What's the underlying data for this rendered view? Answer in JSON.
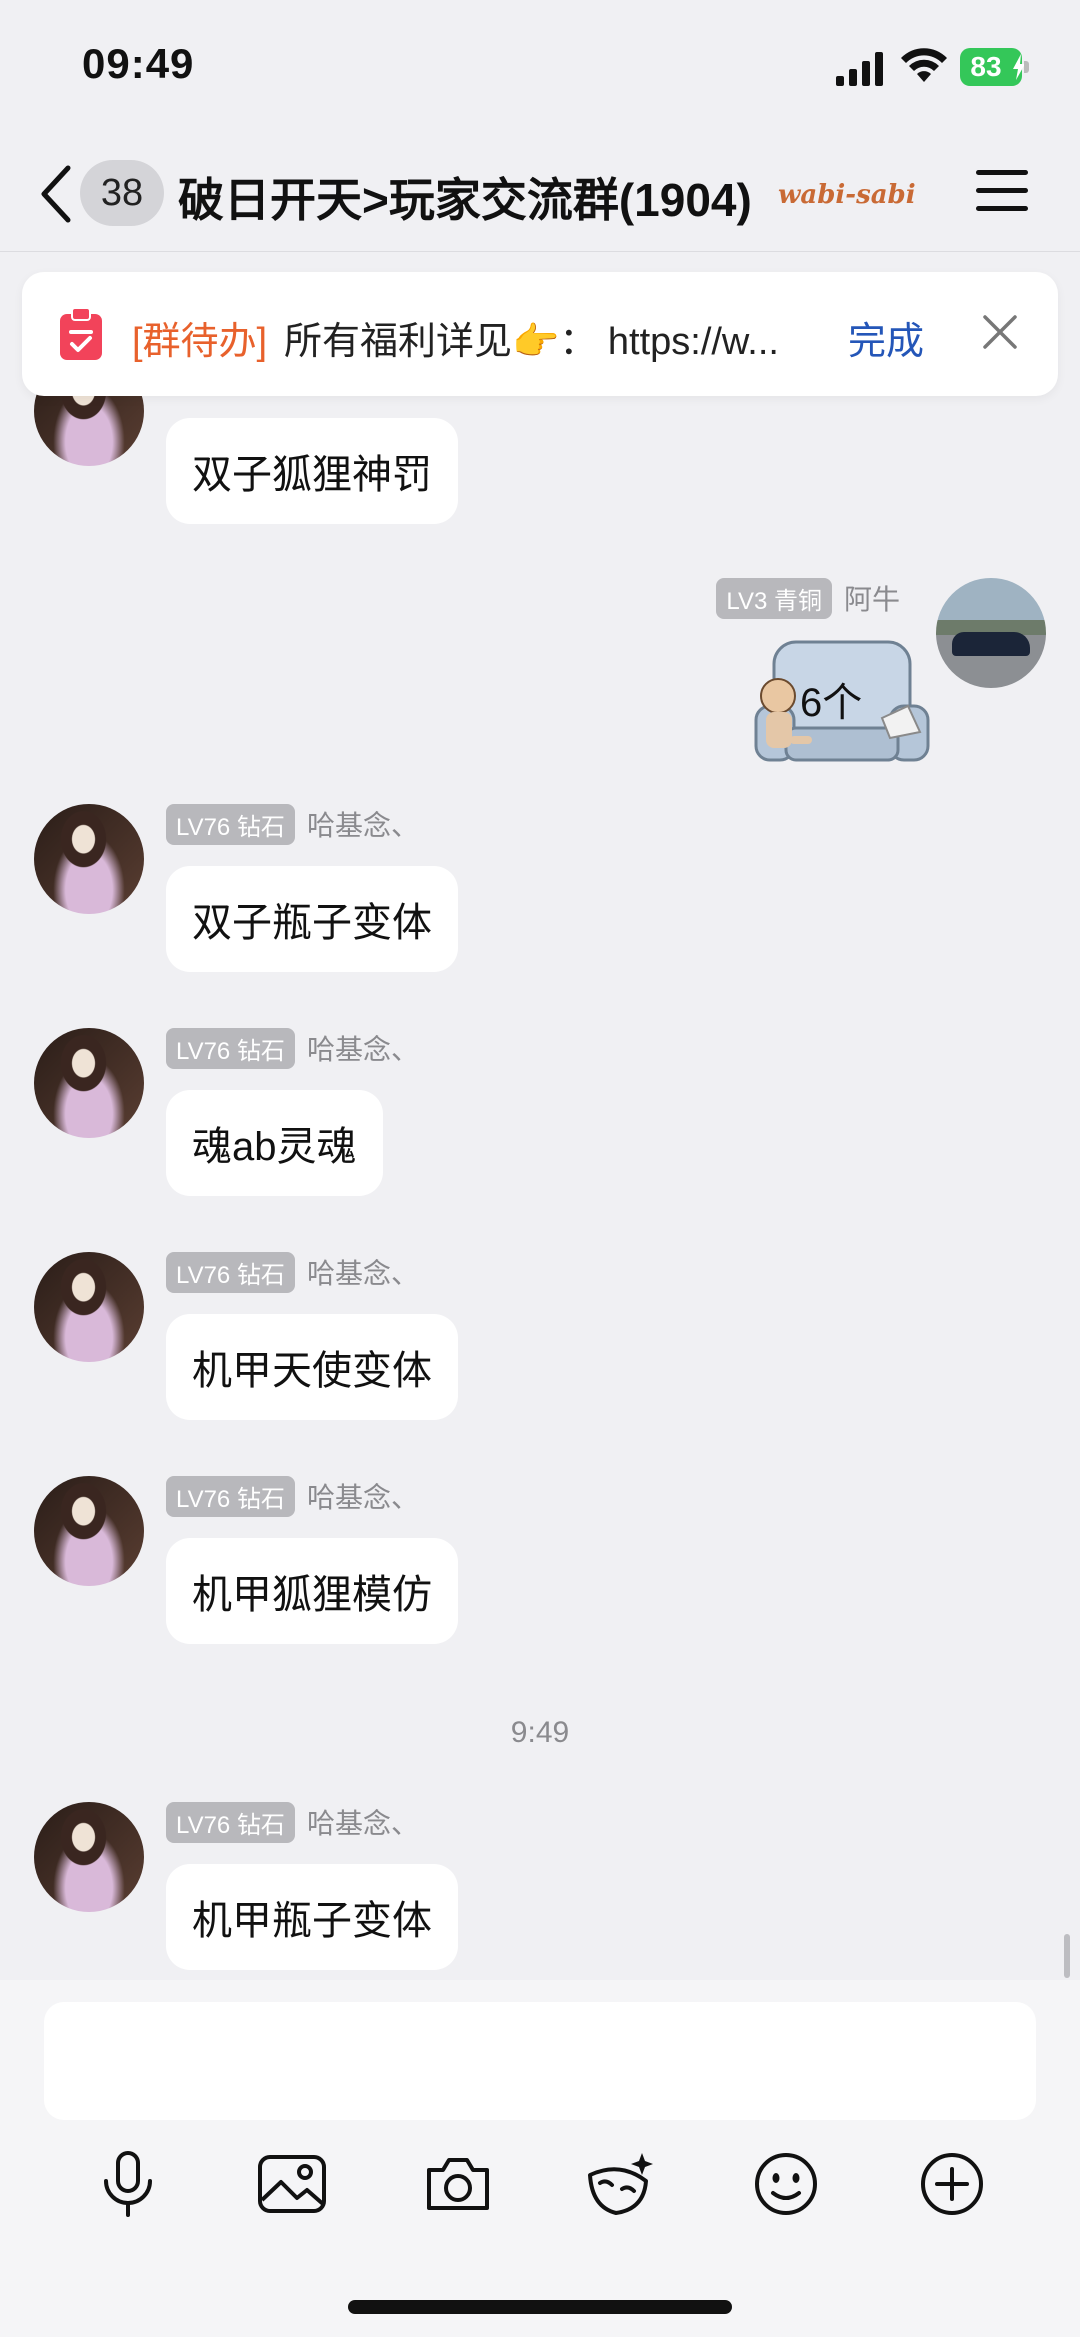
{
  "status_bar": {
    "time": "09:49",
    "battery": "83"
  },
  "nav": {
    "back_badge": "38",
    "title": "破日开天>玩家交流群(1904)",
    "title_deco": "wabi-sabi"
  },
  "todo": {
    "tag": "[群待办]",
    "text": "所有福利详见👉：  https://w...",
    "done_label": "完成"
  },
  "messages": [
    {
      "badge": "",
      "name": "",
      "text": "双子狐狸神罚"
    },
    {
      "badge": "LV3 青铜",
      "name": "阿牛",
      "sticker_text": "6个"
    },
    {
      "badge": "LV76 钻石",
      "name": "哈基念、",
      "text": "双子瓶子变体"
    },
    {
      "badge": "LV76 钻石",
      "name": "哈基念、",
      "text": "魂ab灵魂"
    },
    {
      "badge": "LV76 钻石",
      "name": "哈基念、",
      "text": "机甲天使变体"
    },
    {
      "badge": "LV76 钻石",
      "name": "哈基念、",
      "text": "机甲狐狸模仿"
    },
    {
      "badge": "LV76 钻石",
      "name": "哈基念、",
      "text": "机甲瓶子变体"
    }
  ],
  "time_divider": "9:49",
  "input": {
    "placeholder": ""
  },
  "icons": {
    "toolbar": [
      "microphone-icon",
      "image-icon",
      "camera-icon",
      "magic-face-icon",
      "emoji-icon",
      "plus-icon"
    ]
  },
  "colors": {
    "accent": "#2456b8",
    "todo_tag": "#e8612c",
    "battery": "#34c759",
    "background": "#f0f0f3"
  }
}
